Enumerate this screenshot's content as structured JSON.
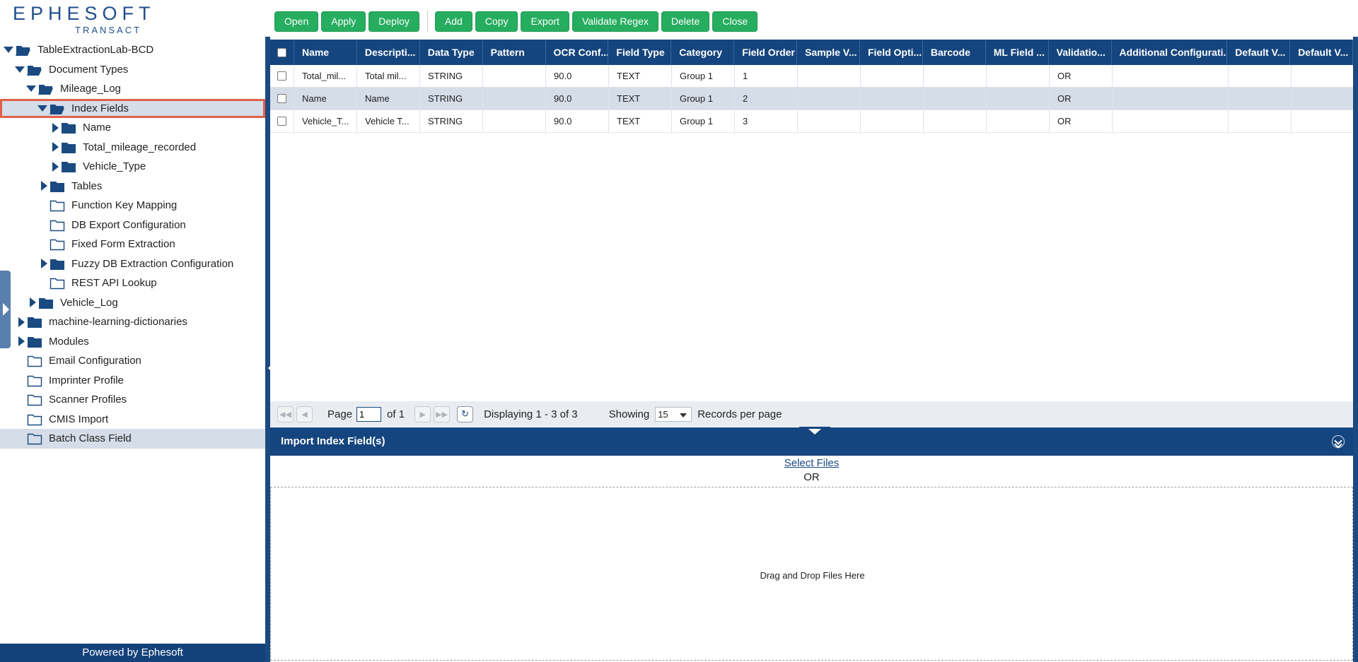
{
  "brand": {
    "name": "EPHESOFT",
    "product": "TRANSACT"
  },
  "tree": [
    {
      "label": "TableExtractionLab-BCD",
      "level": 0,
      "toggle": "down",
      "folder": "open",
      "name": "tree-node-batch-class"
    },
    {
      "label": "Document Types",
      "level": 1,
      "toggle": "down",
      "folder": "open",
      "name": "tree-node-document-types"
    },
    {
      "label": "Mileage_Log",
      "level": 2,
      "toggle": "down",
      "folder": "open",
      "name": "tree-node-mileage-log"
    },
    {
      "label": "Index Fields",
      "level": 3,
      "toggle": "down",
      "folder": "open",
      "name": "tree-node-index-fields",
      "highlight": true
    },
    {
      "label": "Name",
      "level": 4,
      "toggle": "right",
      "folder": "closed",
      "name": "tree-node-name"
    },
    {
      "label": "Total_mileage_recorded",
      "level": 4,
      "toggle": "right",
      "folder": "closed",
      "name": "tree-node-total-mileage"
    },
    {
      "label": "Vehicle_Type",
      "level": 4,
      "toggle": "right",
      "folder": "closed",
      "name": "tree-node-vehicle-type"
    },
    {
      "label": "Tables",
      "level": 3,
      "toggle": "right",
      "folder": "closed",
      "name": "tree-node-tables"
    },
    {
      "label": "Function Key Mapping",
      "level": 3,
      "toggle": "none",
      "folder": "empty",
      "name": "tree-node-function-key-mapping"
    },
    {
      "label": "DB Export Configuration",
      "level": 3,
      "toggle": "none",
      "folder": "empty",
      "name": "tree-node-db-export"
    },
    {
      "label": "Fixed Form Extraction",
      "level": 3,
      "toggle": "none",
      "folder": "empty",
      "name": "tree-node-fixed-form"
    },
    {
      "label": "Fuzzy DB Extraction Configuration",
      "level": 3,
      "toggle": "right",
      "folder": "closed",
      "name": "tree-node-fuzzy-db"
    },
    {
      "label": "REST API Lookup",
      "level": 3,
      "toggle": "none",
      "folder": "empty",
      "name": "tree-node-rest-api"
    },
    {
      "label": "Vehicle_Log",
      "level": 2,
      "toggle": "right",
      "folder": "closed",
      "name": "tree-node-vehicle-log"
    },
    {
      "label": "machine-learning-dictionaries",
      "level": 1,
      "toggle": "right",
      "folder": "closed",
      "name": "tree-node-ml-dictionaries"
    },
    {
      "label": "Modules",
      "level": 1,
      "toggle": "right",
      "folder": "closed",
      "name": "tree-node-modules"
    },
    {
      "label": "Email Configuration",
      "level": 1,
      "toggle": "none",
      "folder": "empty",
      "name": "tree-node-email-config"
    },
    {
      "label": "Imprinter Profile",
      "level": 1,
      "toggle": "none",
      "folder": "empty",
      "name": "tree-node-imprinter"
    },
    {
      "label": "Scanner Profiles",
      "level": 1,
      "toggle": "none",
      "folder": "empty",
      "name": "tree-node-scanner"
    },
    {
      "label": "CMIS Import",
      "level": 1,
      "toggle": "none",
      "folder": "empty",
      "name": "tree-node-cmis"
    },
    {
      "label": "Batch Class Field",
      "level": 1,
      "toggle": "none",
      "folder": "empty",
      "name": "tree-node-batch-class-field",
      "selected": true
    }
  ],
  "footer": {
    "powered": "Powered by Ephesoft"
  },
  "toolbar": {
    "group1": [
      "Open",
      "Apply",
      "Deploy"
    ],
    "group2": [
      "Add",
      "Copy",
      "Export",
      "Validate Regex",
      "Delete",
      "Close"
    ]
  },
  "grid": {
    "columns": [
      "Name",
      "Descripti...",
      "Data Type",
      "Pattern",
      "OCR Conf...",
      "Field Type",
      "Category",
      "Field Order",
      "Sample V...",
      "Field Opti...",
      "Barcode",
      "ML Field ...",
      "Validatio...",
      "Additional Configurati...",
      "Default V...",
      "Default V..."
    ],
    "rows": [
      [
        "Total_mil...",
        "Total mil...",
        "STRING",
        "",
        "90.0",
        "TEXT",
        "Group 1",
        "1",
        "",
        "",
        "",
        "",
        "OR",
        "",
        "",
        ""
      ],
      [
        "Name",
        "Name",
        "STRING",
        "",
        "90.0",
        "TEXT",
        "Group 1",
        "2",
        "",
        "",
        "",
        "",
        "OR",
        "",
        "",
        ""
      ],
      [
        "Vehicle_T...",
        "Vehicle T...",
        "STRING",
        "",
        "90.0",
        "TEXT",
        "Group 1",
        "3",
        "",
        "",
        "",
        "",
        "OR",
        "",
        "",
        ""
      ]
    ]
  },
  "pager": {
    "page_label": "Page",
    "page_value": "1",
    "of_label": "of 1",
    "displaying": "Displaying 1 - 3 of 3",
    "showing": "Showing",
    "per_page_value": "15",
    "per_page_suffix": "Records per page"
  },
  "import": {
    "title": "Import Index Field(s)",
    "select_files": "Select Files",
    "or": "OR",
    "drop": "Drag and Drop Files Here"
  },
  "colors": {
    "brand_blue": "#15457e",
    "button_green": "#26ad5f",
    "highlight_red": "#e0604a",
    "selected_row": "#d5dde8"
  }
}
